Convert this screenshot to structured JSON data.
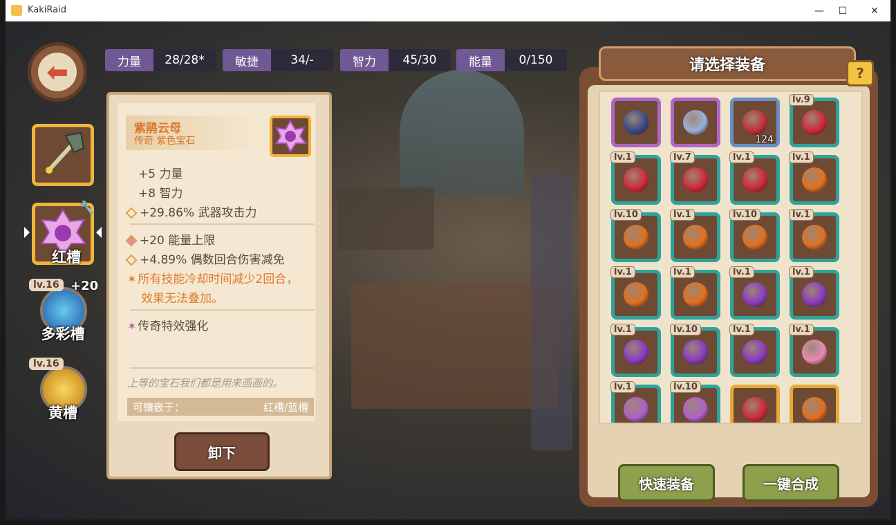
{
  "window": {
    "title": "KakiRaid",
    "minimize": "—",
    "maximize": "☐",
    "close": "✕"
  },
  "stats": [
    {
      "label": "力量",
      "value": "28/28*"
    },
    {
      "label": "敏捷",
      "value": "34/-"
    },
    {
      "label": "智力",
      "value": "45/30"
    },
    {
      "label": "能量",
      "value": "0/150"
    }
  ],
  "slots": {
    "red": "红槽",
    "multicolor": "多彩槽",
    "multicolor_level": "lv.16",
    "multicolor_bonus": "+20",
    "yellow": "黄槽",
    "yellow_level": "lv.16"
  },
  "detail": {
    "name": "紫鹃云母",
    "type": "传奇 紫色宝石",
    "lines": [
      "+5 力量",
      "+8 智力",
      "+29.86% 武器攻击力",
      "+20 能量上限",
      "+4.89% 偶数回合伤害减免",
      "所有技能冷却时间减少2回合，",
      "效果无法叠加。",
      "传奇特效强化"
    ],
    "description": "上等的宝石我们都是用来画画的。",
    "inlay_label": "可镶嵌于：",
    "inlay_value": "红槽/蓝槽",
    "unequip": "卸下"
  },
  "panel": {
    "title": "请选择装备",
    "help": "?",
    "quick_equip": "快速装备",
    "one_key_merge": "一键合成"
  },
  "gems": [
    {
      "frame": "purple",
      "color": "#3a4a8a",
      "level": "",
      "count": ""
    },
    {
      "frame": "purple",
      "color": "#9ab0d8",
      "level": "",
      "count": ""
    },
    {
      "frame": "blue",
      "color": "#c0303a",
      "level": "",
      "count": "124"
    },
    {
      "frame": "teal",
      "color": "#d0283a",
      "level": "lv.9",
      "count": ""
    },
    {
      "frame": "teal",
      "color": "#d0283a",
      "level": "lv.1",
      "count": ""
    },
    {
      "frame": "teal",
      "color": "#d0283a",
      "level": "lv.7",
      "count": ""
    },
    {
      "frame": "teal",
      "color": "#d0283a",
      "level": "lv.1",
      "count": ""
    },
    {
      "frame": "teal",
      "color": "#e0701e",
      "level": "lv.1",
      "count": ""
    },
    {
      "frame": "teal",
      "color": "#e0701e",
      "level": "lv.10",
      "count": ""
    },
    {
      "frame": "teal",
      "color": "#e0701e",
      "level": "lv.1",
      "count": ""
    },
    {
      "frame": "teal",
      "color": "#e0701e",
      "level": "lv.10",
      "count": ""
    },
    {
      "frame": "teal",
      "color": "#e0701e",
      "level": "lv.1",
      "count": ""
    },
    {
      "frame": "teal",
      "color": "#e0701e",
      "level": "lv.1",
      "count": ""
    },
    {
      "frame": "teal",
      "color": "#e0701e",
      "level": "lv.1",
      "count": ""
    },
    {
      "frame": "teal",
      "color": "#8a3ac0",
      "level": "lv.1",
      "count": ""
    },
    {
      "frame": "teal",
      "color": "#8a3ac0",
      "level": "lv.1",
      "count": ""
    },
    {
      "frame": "teal",
      "color": "#8a3ac0",
      "level": "lv.1",
      "count": ""
    },
    {
      "frame": "teal",
      "color": "#8a3ac0",
      "level": "lv.10",
      "count": ""
    },
    {
      "frame": "teal",
      "color": "#8a3ac0",
      "level": "lv.1",
      "count": ""
    },
    {
      "frame": "teal",
      "color": "#e88ab0",
      "level": "lv.1",
      "count": ""
    },
    {
      "frame": "teal",
      "color": "#b060c8",
      "level": "lv.1",
      "count": ""
    },
    {
      "frame": "teal",
      "color": "#b060c8",
      "level": "lv.10",
      "count": ""
    },
    {
      "frame": "gold",
      "color": "#d0283a",
      "level": "",
      "count": ""
    },
    {
      "frame": "gold",
      "color": "#e0701e",
      "level": "",
      "count": ""
    }
  ]
}
